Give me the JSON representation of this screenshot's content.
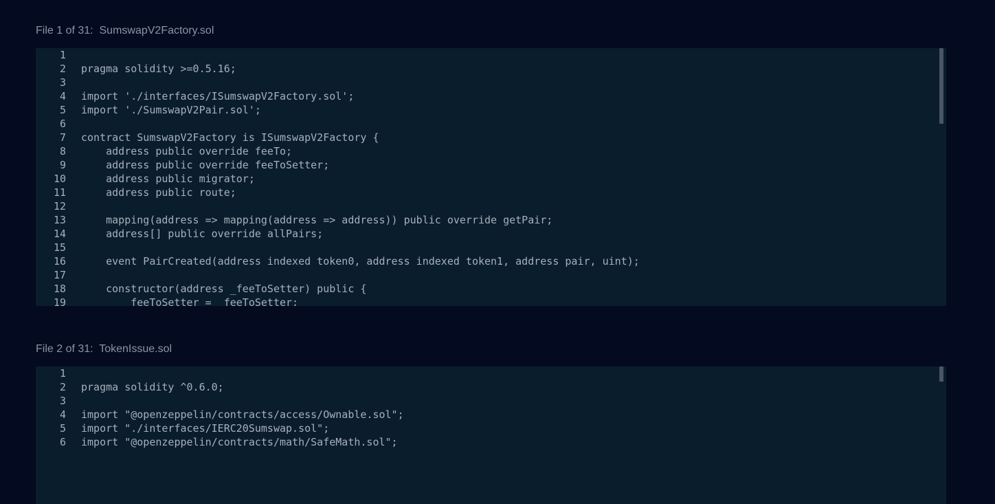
{
  "files": [
    {
      "header": "File 1 of 31:  SumswapV2Factory.sol",
      "lines": [
        "",
        "pragma solidity >=0.5.16;",
        "",
        "import './interfaces/ISumswapV2Factory.sol';",
        "import './SumswapV2Pair.sol';",
        "",
        "contract SumswapV2Factory is ISumswapV2Factory {",
        "    address public override feeTo;",
        "    address public override feeToSetter;",
        "    address public migrator;",
        "    address public route;",
        "",
        "    mapping(address => mapping(address => address)) public override getPair;",
        "    address[] public override allPairs;",
        "",
        "    event PairCreated(address indexed token0, address indexed token1, address pair, uint);",
        "",
        "    constructor(address _feeToSetter) public {",
        "        feeToSetter = _feeToSetter;"
      ]
    },
    {
      "header": "File 2 of 31:  TokenIssue.sol",
      "lines": [
        "",
        "pragma solidity ^0.6.0;",
        "",
        "import \"@openzeppelin/contracts/access/Ownable.sol\";",
        "import \"./interfaces/IERC20Sumswap.sol\";",
        "import \"@openzeppelin/contracts/math/SafeMath.sol\";"
      ]
    }
  ]
}
